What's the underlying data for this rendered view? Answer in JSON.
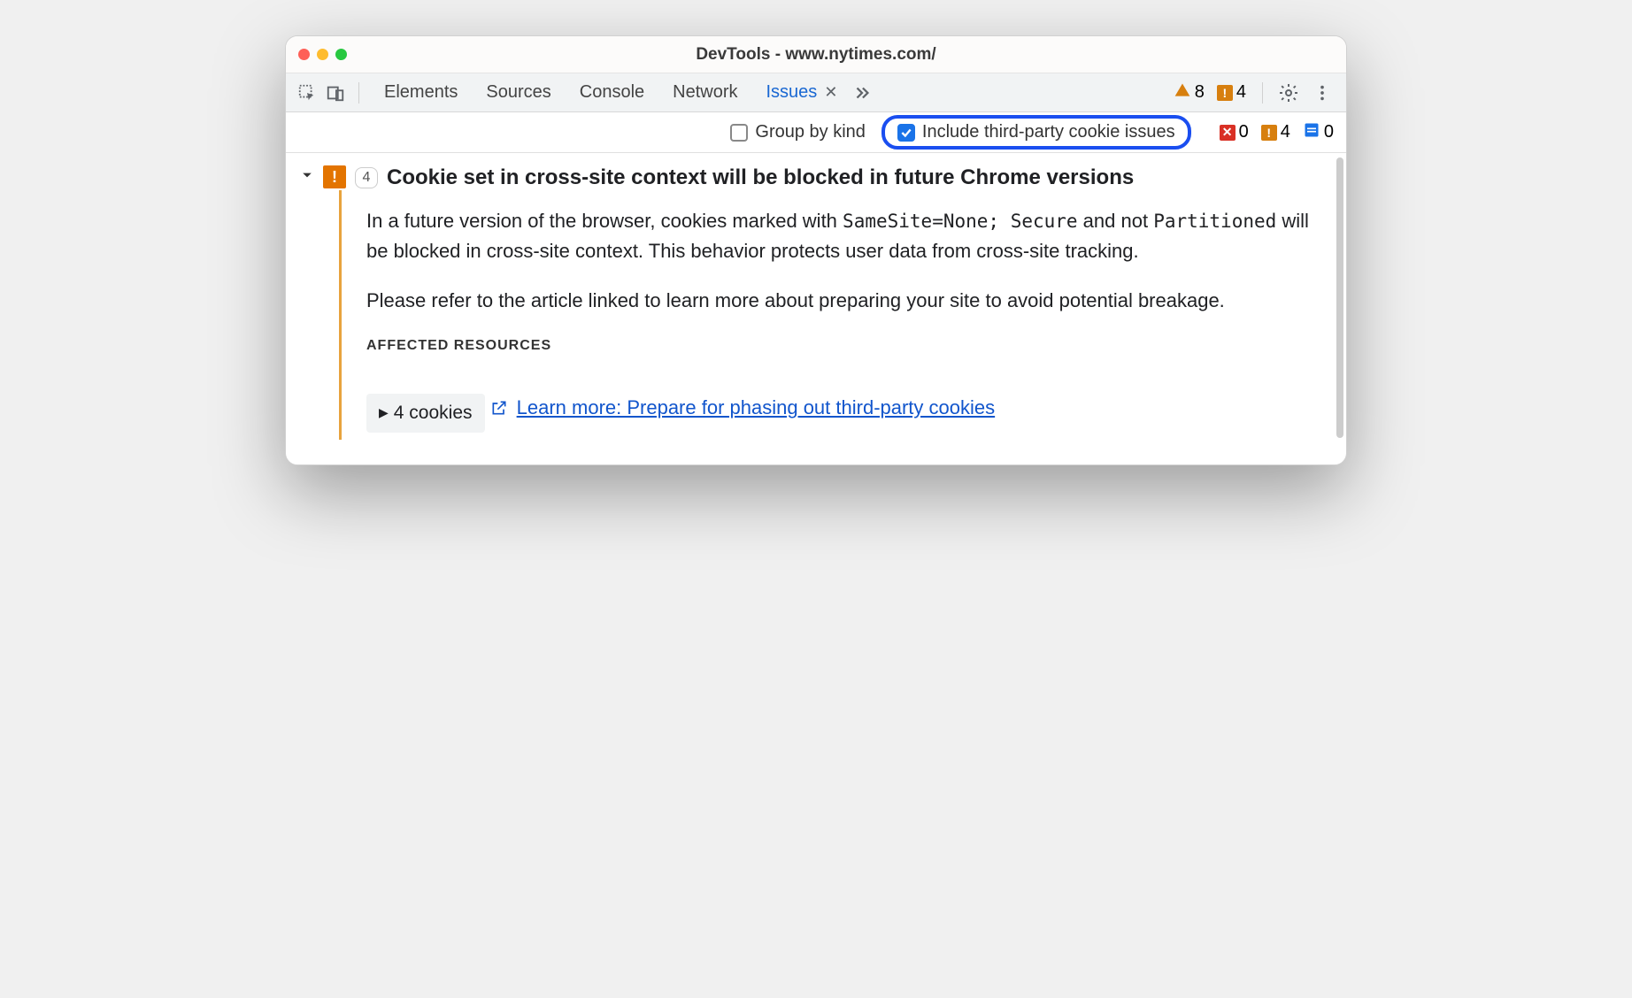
{
  "window": {
    "title": "DevTools - www.nytimes.com/"
  },
  "tabs": {
    "elements": "Elements",
    "sources": "Sources",
    "console": "Console",
    "network": "Network",
    "issues": "Issues"
  },
  "toolbar_counts": {
    "warnings": "8",
    "breaking": "4"
  },
  "filters": {
    "group_by_kind": "Group by kind",
    "include_third_party": "Include third-party cookie issues"
  },
  "issue_counts": {
    "errors": "0",
    "breaking": "4",
    "info": "0"
  },
  "issue": {
    "count": "4",
    "title": "Cookie set in cross-site context will be blocked in future Chrome versions",
    "p1_a": "In a future version of the browser, cookies marked with ",
    "code1": "SameSite=None; Secure",
    "p1_b": " and not ",
    "code2": "Partitioned",
    "p1_c": " will be blocked in cross-site context. This behavior protects user data from cross-site tracking.",
    "p2": "Please refer to the article linked to learn more about preparing your site to avoid potential breakage.",
    "affected_header": "Affected Resources",
    "affected_item": "4 cookies",
    "learn_more": "Learn more: Prepare for phasing out third-party cookies"
  }
}
